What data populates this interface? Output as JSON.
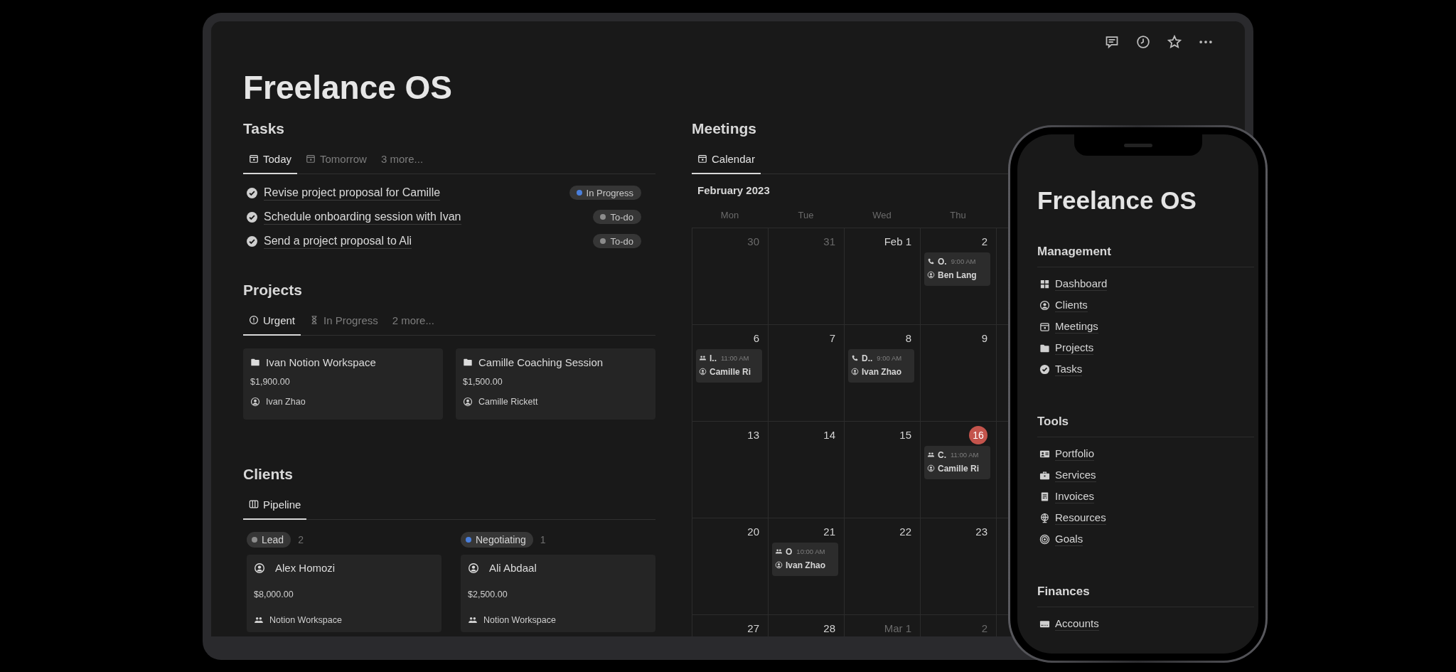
{
  "page": {
    "title": "Freelance OS"
  },
  "tasks": {
    "heading": "Tasks",
    "tabs": [
      {
        "label": "Today",
        "kind": "calendar",
        "selected": true
      },
      {
        "label": "Tomorrow",
        "kind": "calendar",
        "selected": false
      },
      {
        "label": "3 more...",
        "kind": "more",
        "selected": false
      }
    ],
    "items": [
      {
        "title": "Revise project proposal for Camille",
        "status": "In Progress",
        "color": "#4a7fdc"
      },
      {
        "title": "Schedule onboarding session with Ivan",
        "status": "To-do",
        "color": "#8c8c8c"
      },
      {
        "title": "Send a project proposal to Ali",
        "status": "To-do",
        "color": "#8c8c8c"
      }
    ]
  },
  "projects": {
    "heading": "Projects",
    "tabs": [
      {
        "label": "Urgent",
        "kind": "alert",
        "selected": true
      },
      {
        "label": "In Progress",
        "kind": "hourglass",
        "selected": false
      },
      {
        "label": "2 more...",
        "kind": "more",
        "selected": false
      }
    ],
    "cards": [
      {
        "title": "Ivan Notion Workspace",
        "amount": "$1,900.00",
        "person": "Ivan Zhao"
      },
      {
        "title": "Camille Coaching Session",
        "amount": "$1,500.00",
        "person": "Camille Rickett"
      }
    ]
  },
  "clients": {
    "heading": "Clients",
    "tabs": [
      {
        "label": "Pipeline",
        "kind": "columns",
        "selected": true
      }
    ],
    "groups": [
      {
        "label": "Lead",
        "count": "2",
        "color": "#8c8c8c",
        "cards": [
          {
            "name": "Alex Homozi",
            "amount": "$8,000.00",
            "company": "Notion Workspace"
          }
        ]
      },
      {
        "label": "Negotiating",
        "count": "1",
        "color": "#4a7fdc",
        "cards": [
          {
            "name": "Ali Abdaal",
            "amount": "$2,500.00",
            "company": "Notion Workspace"
          }
        ]
      }
    ]
  },
  "meetings": {
    "heading": "Meetings",
    "tabs": [
      {
        "label": "Calendar",
        "kind": "calendar",
        "selected": true
      }
    ],
    "month": "February 2023",
    "weekdays": [
      "Mon",
      "Tue",
      "Wed",
      "Thu"
    ],
    "weeks": [
      {
        "days": [
          {
            "label": "30",
            "muted": true,
            "today": false
          },
          {
            "label": "31",
            "muted": true,
            "today": false
          },
          {
            "label": "Feb 1",
            "muted": false,
            "today": false
          },
          {
            "label": "2",
            "muted": false,
            "today": false,
            "events": [
              {
                "kind": "call",
                "title": "O.",
                "time": "9:00 AM",
                "person": "Ben Lang"
              }
            ]
          }
        ]
      },
      {
        "days": [
          {
            "label": "6",
            "muted": false,
            "today": false,
            "events": [
              {
                "kind": "meeting",
                "title": "I..",
                "time": "11:00 AM",
                "person": "Camille Ri"
              }
            ]
          },
          {
            "label": "7",
            "muted": false,
            "today": false
          },
          {
            "label": "8",
            "muted": false,
            "today": false,
            "events": [
              {
                "kind": "call",
                "title": "D..",
                "time": "9:00 AM",
                "person": "Ivan Zhao"
              }
            ]
          },
          {
            "label": "9",
            "muted": false,
            "today": false
          }
        ]
      },
      {
        "days": [
          {
            "label": "13",
            "muted": false,
            "today": false
          },
          {
            "label": "14",
            "muted": false,
            "today": false
          },
          {
            "label": "15",
            "muted": false,
            "today": false
          },
          {
            "label": "16",
            "muted": false,
            "today": true,
            "events": [
              {
                "kind": "meeting",
                "title": "C.",
                "time": "11:00 AM",
                "person": "Camille Ri"
              }
            ]
          }
        ]
      },
      {
        "days": [
          {
            "label": "20",
            "muted": false,
            "today": false
          },
          {
            "label": "21",
            "muted": false,
            "today": false,
            "events": [
              {
                "kind": "meeting",
                "title": "O",
                "time": "10:00 AM",
                "person": "Ivan Zhao"
              }
            ]
          },
          {
            "label": "22",
            "muted": false,
            "today": false
          },
          {
            "label": "23",
            "muted": false,
            "today": false
          }
        ]
      },
      {
        "days": [
          {
            "label": "27",
            "muted": false,
            "today": false
          },
          {
            "label": "28",
            "muted": false,
            "today": false
          },
          {
            "label": "Mar 1",
            "muted": true,
            "today": false
          },
          {
            "label": "2",
            "muted": true,
            "today": false
          }
        ]
      }
    ]
  },
  "phone": {
    "title": "Freelance OS",
    "sections": [
      {
        "heading": "Management",
        "items": [
          {
            "label": "Dashboard",
            "kind": "grid"
          },
          {
            "label": "Clients",
            "kind": "person"
          },
          {
            "label": "Meetings",
            "kind": "calendar"
          },
          {
            "label": "Projects",
            "kind": "folder"
          },
          {
            "label": "Tasks",
            "kind": "check"
          }
        ]
      },
      {
        "heading": "Tools",
        "items": [
          {
            "label": "Portfolio",
            "kind": "idcard"
          },
          {
            "label": "Services",
            "kind": "briefcase"
          },
          {
            "label": "Invoices",
            "kind": "document"
          },
          {
            "label": "Resources",
            "kind": "globe"
          },
          {
            "label": "Goals",
            "kind": "target"
          }
        ]
      },
      {
        "heading": "Finances",
        "items": [
          {
            "label": "Accounts",
            "kind": "card"
          }
        ]
      }
    ]
  }
}
